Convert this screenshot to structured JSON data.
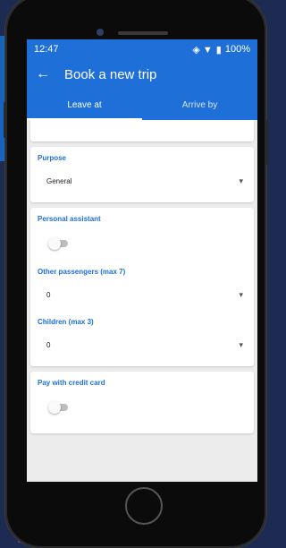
{
  "status": {
    "time": "12:47",
    "icons": "◈ ▼",
    "battery": "100%"
  },
  "appbar": {
    "back_icon": "←",
    "title": "Book a new trip"
  },
  "tabs": [
    {
      "label": "Leave at"
    },
    {
      "label": "Arrive by"
    }
  ],
  "form": {
    "purpose": {
      "label": "Purpose",
      "value": "General"
    },
    "personal_assistant": {
      "label": "Personal assistant",
      "checked": false
    },
    "other_passengers": {
      "label": "Other passengers (max 7)",
      "value": "0"
    },
    "children": {
      "label": "Children (max 3)",
      "value": "0"
    },
    "pay_credit": {
      "label": "Pay with credit card",
      "checked": false
    }
  },
  "colors": {
    "primary": "#1e6fd8",
    "background": "#ececec"
  }
}
